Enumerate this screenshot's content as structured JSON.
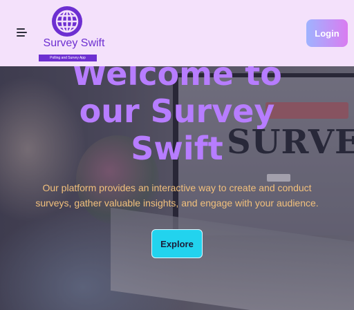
{
  "header": {
    "brand_name": "Survey Swift",
    "brand_tagline": "Polling and Survey App",
    "login_label": "Login"
  },
  "hero": {
    "title": "Welcome to our Survey Swift",
    "description": "Our platform provides an interactive way to create and conduct surveys, gather valuable insights, and engage with your audience.",
    "explore_label": "Explore",
    "background_screen_text": "SURVEY"
  },
  "icons": {
    "menu": "hamburger-menu-icon",
    "logo": "globe-icon"
  },
  "colors": {
    "header_bg": "#f4e1fb",
    "brand": "#6d2fd1",
    "title": "#b77dff",
    "description": "#f2c07c",
    "explore_bg": "#22d3ee",
    "login_gradient_start": "#9fb3ff",
    "login_gradient_end": "#d97cf0"
  }
}
